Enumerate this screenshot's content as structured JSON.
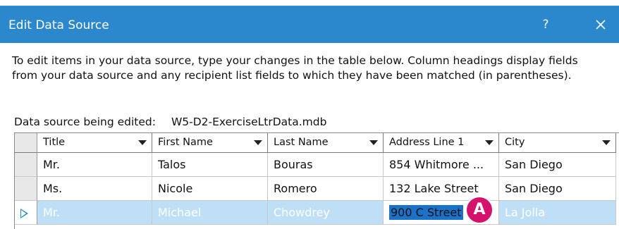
{
  "dialog": {
    "title": "Edit Data Source",
    "help_label": "?",
    "instructions": "To edit items in your data source, type your changes in the table below. Column headings display fields from your data source and any recipient list fields to which they have been matched (in parentheses).",
    "source_label": "Data source being edited:",
    "source_file": "W5-D2-ExerciseLtrData.mdb"
  },
  "table": {
    "columns": [
      "Title",
      "First Name",
      "Last Name",
      "Address Line 1",
      "City"
    ],
    "rows": [
      [
        "Mr.",
        "Talos",
        "Bouras",
        "854 Whitmore ...",
        "San Diego"
      ],
      [
        "Ms.",
        "Nicole",
        "Romero",
        "132 Lake Street",
        "San Diego"
      ],
      [
        "Mr.",
        "Michael",
        "Chowdrey",
        "900 C Street",
        "La Jolla"
      ]
    ],
    "selected_row": 2,
    "editing_cell": "900 C Street"
  },
  "callout": {
    "label": "A",
    "color": "#d4126b"
  },
  "colors": {
    "titlebar": "#2b88cc",
    "selection": "#bfdff7"
  }
}
